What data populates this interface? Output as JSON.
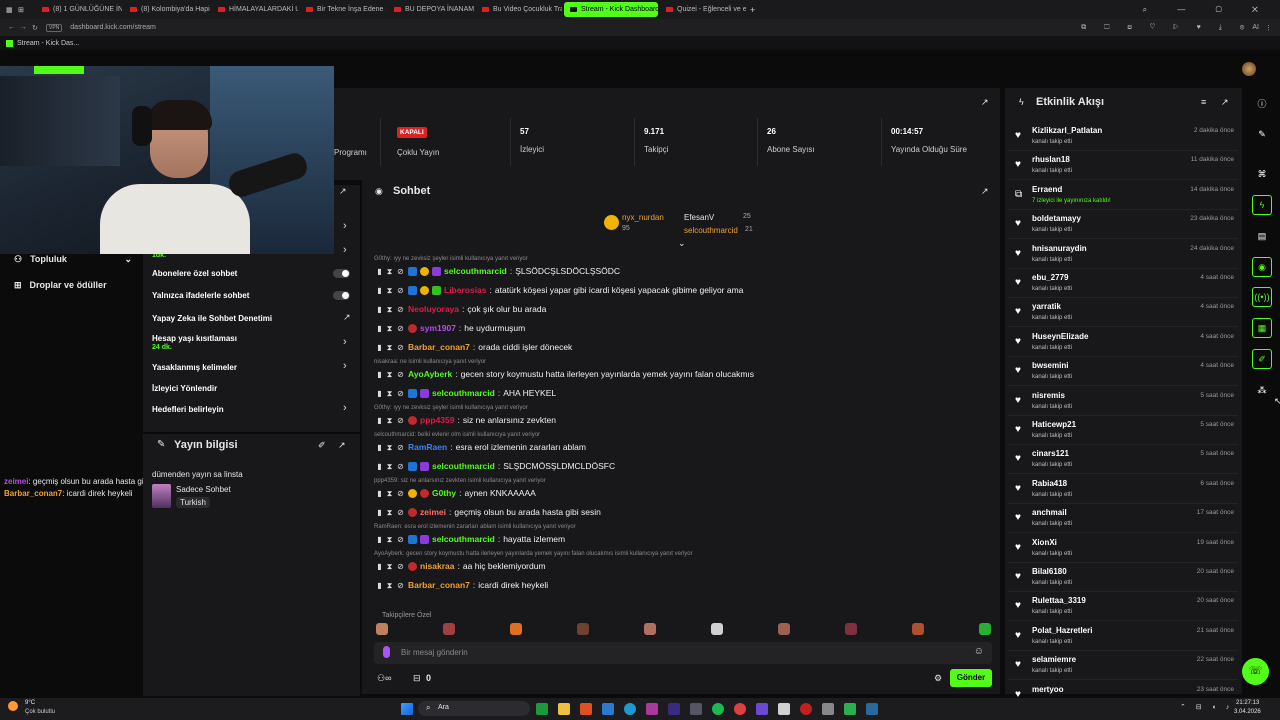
{
  "browser": {
    "tabs": [
      {
        "label": "(8) 1 GÜNLÜĞÜNE İNTER"
      },
      {
        "label": "(8) Kolombiya'da Hapish"
      },
      {
        "label": "HİMALAYALARDAKİ UÇAK"
      },
      {
        "label": "Bir Tekne İnşa Edene Kaç"
      },
      {
        "label": "BU DEPOYA İNANAMAYA"
      },
      {
        "label": "Bu Video Çocukluk Travm"
      },
      {
        "label": "Stream - Kick Dashboard"
      },
      {
        "label": "Quizei - Eğlenceli ve etkin"
      }
    ],
    "address": "dashboard.kick.com/stream",
    "bookmark": "Stream - Kick Das...",
    "ai_label": "AI"
  },
  "stats": [
    {
      "value": "",
      "label": "Programı"
    },
    {
      "value": "KAPALI",
      "label": "Çoklu Yayın"
    },
    {
      "value": "57",
      "label": "İzleyici"
    },
    {
      "value": "9.171",
      "label": "Takipçi"
    },
    {
      "value": "26",
      "label": "Abone Sayısı"
    },
    {
      "value": "00:14:57",
      "label": "Yayında Olduğu Süre"
    }
  ],
  "leftnav": {
    "items": [
      {
        "label": "Topluluk"
      },
      {
        "label": "Droplar ve ödüller"
      }
    ]
  },
  "chat_settings": {
    "partial_top": "1dk.",
    "items": [
      {
        "label": "Abonelere özel sohbet"
      },
      {
        "label": "Yalnızca ifadelerle sohbet"
      },
      {
        "label": "Yapay Zeka ile Sohbet Denetimi"
      },
      {
        "label": "Hesap yaşı kısıtlaması",
        "sub": "24 dk."
      },
      {
        "label": "Yasaklanmış kelimeler"
      },
      {
        "label": "İzleyici Yönlendir"
      },
      {
        "label": "Hedefleri belirleyin"
      }
    ]
  },
  "stream_info": {
    "title": "Yayın bilgisi",
    "stream_title": "dümenden yayın sa linsta",
    "category": "Sadece Sohbet",
    "language": "Turkish"
  },
  "overlay_chat": [
    {
      "user": "zeimei",
      "text": "geçmiş olsun bu arada hasta gibi sesin"
    },
    {
      "user": "Barbar_conan7",
      "text": "icardi direk heykeli"
    }
  ],
  "chat": {
    "title": "Sohbet",
    "top_gifters": [
      {
        "name": "nyx_nurdan",
        "count": "95"
      },
      {
        "name": "EfesanV",
        "count": "25"
      },
      {
        "name": "selcouthmarcid",
        "count": "21"
      }
    ],
    "messages": [
      {
        "reply": "G0thy: ıyy ne zevksiz şeyler isimli kullanıcıya yanıt veriyor",
        "user": "selcouthmarcid",
        "color": "#53fc18",
        "text": "ŞLSÖDCŞLSDÖCLŞSÖDC"
      },
      {
        "reply": "",
        "user": "Liberosias",
        "color": "#e0194a",
        "text": "atatürk köşesi yapar gibi icardi köşesi yapacak gibime geliyor ama"
      },
      {
        "reply": "",
        "user": "Neoluyoraya",
        "color": "#e0194a",
        "text": "çok şık olur bu arada"
      },
      {
        "reply": "",
        "user": "sym1907",
        "color": "#b84ce8",
        "text": "he uydurmuşum"
      },
      {
        "reply": "",
        "user": "Barbar_conan7",
        "color": "#f0a030",
        "text": "orada ciddi işler dönecek"
      },
      {
        "reply": "nisakraa: ne isimli kullanıcıya yanıt veriyor",
        "user": "AyoAyberk",
        "color": "#53fc18",
        "text": "gecen story koymustu hatta ilerleyen yayınlarda yemek yayını falan olucakmıs"
      },
      {
        "reply": "",
        "user": "selcouthmarcid",
        "color": "#53fc18",
        "text": "AHA HEYKEL"
      },
      {
        "reply": "G0thy: ıyy ne zevksiz şeyler isimli kullanıcıya yanıt veriyor",
        "user": "ppp4359",
        "color": "#e0194a",
        "text": "siz ne anlarsınız zevkten"
      },
      {
        "reply": "selcouthmarcid: belki evlenir olm isimli kullanıcıya yanıt veriyor",
        "user": "RamRaen",
        "color": "#3b82f6",
        "text": "esra erol izlemenin zararları ablam"
      },
      {
        "reply": "",
        "user": "selcouthmarcid",
        "color": "#53fc18",
        "text": "SLŞDCMÖSŞLDMCLDÖSFC"
      },
      {
        "reply": "ppp4359: siz ne anlarsınız zevkten isimli kullanıcıya yanıt veriyor",
        "user": "G0thy",
        "color": "#53fc18",
        "text": "aynen KNKAAAAA"
      },
      {
        "reply": "",
        "user": "zeimei",
        "color": "#ff6b6b",
        "text": "geçmiş olsun bu arada hasta gibi sesin"
      },
      {
        "reply": "RamRaen: esra erol izlemenin zararları ablam isimli kullanıcıya yanıt veriyor",
        "user": "selcouthmarcid",
        "color": "#53fc18",
        "text": "hayatta izlemem"
      },
      {
        "reply": "AyoAyberk: gecen story koymustu hatta ilerleyen yayınlarda yemek yayını falan olucakmıs isimli kullanıcıya yanıt veriyor",
        "user": "nisakraa",
        "color": "#f0a030",
        "text": "aa hiç beklemiyordum"
      },
      {
        "reply": "",
        "user": "Barbar_conan7",
        "color": "#f0a030",
        "text": "icardi direk heykeli"
      }
    ],
    "followers_label": "Takipçilere Özel",
    "input_placeholder": "Bir mesaj gönderin",
    "points": "0",
    "send_label": "Gönder"
  },
  "activity": {
    "title": "Etkinlik Akışı",
    "events": [
      {
        "name": "Kizlikzarl_Patlatan",
        "sub": "kanalı takip etti",
        "time": "2 dakika önce",
        "icon": "heart"
      },
      {
        "name": "rhuslan18",
        "sub": "kanalı takip etti",
        "time": "11 dakika önce",
        "icon": "heart"
      },
      {
        "name": "Erraend",
        "sub": "7 izleyici ile yayınınıza katıldı!",
        "time": "14 dakika önce",
        "icon": "raid"
      },
      {
        "name": "boldetamayy",
        "sub": "kanalı takip etti",
        "time": "23 dakika önce",
        "icon": "heart"
      },
      {
        "name": "hnisanuraydin",
        "sub": "kanalı takip etti",
        "time": "24 dakika önce",
        "icon": "heart"
      },
      {
        "name": "ebu_2779",
        "sub": "kanalı takip etti",
        "time": "4 saat önce",
        "icon": "heart"
      },
      {
        "name": "yarratik",
        "sub": "kanalı takip etti",
        "time": "4 saat önce",
        "icon": "heart"
      },
      {
        "name": "HuseynElizade",
        "sub": "kanalı takip etti",
        "time": "4 saat önce",
        "icon": "heart"
      },
      {
        "name": "bwsemini",
        "sub": "kanalı takip etti",
        "time": "4 saat önce",
        "icon": "heart"
      },
      {
        "name": "nisremis",
        "sub": "kanalı takip etti",
        "time": "5 saat önce",
        "icon": "heart"
      },
      {
        "name": "Haticewp21",
        "sub": "kanalı takip etti",
        "time": "5 saat önce",
        "icon": "heart"
      },
      {
        "name": "cinars121",
        "sub": "kanalı takip etti",
        "time": "5 saat önce",
        "icon": "heart"
      },
      {
        "name": "Rabia418",
        "sub": "kanalı takip etti",
        "time": "6 saat önce",
        "icon": "heart"
      },
      {
        "name": "anchmail",
        "sub": "kanalı takip etti",
        "time": "17 saat önce",
        "icon": "heart"
      },
      {
        "name": "XionXi",
        "sub": "kanalı takip etti",
        "time": "19 saat önce",
        "icon": "heart"
      },
      {
        "name": "Bilal6180",
        "sub": "kanalı takip etti",
        "time": "20 saat önce",
        "icon": "heart"
      },
      {
        "name": "Rulettaa_3319",
        "sub": "kanalı takip etti",
        "time": "20 saat önce",
        "icon": "heart"
      },
      {
        "name": "Polat_Hazretleri",
        "sub": "kanalı takip etti",
        "time": "21 saat önce",
        "icon": "heart"
      },
      {
        "name": "selamiemre",
        "sub": "kanalı takip etti",
        "time": "22 saat önce",
        "icon": "heart"
      },
      {
        "name": "mertyoo",
        "sub": "",
        "time": "23 saat önce",
        "icon": "heart"
      }
    ]
  },
  "taskbar": {
    "weather_temp": "9°C",
    "weather_desc": "Çok bulutlu",
    "search": "Ara",
    "time": "21:27:13",
    "date": "3.04.2026"
  },
  "colors": {
    "accent": "#53fc18",
    "panel": "#18181b",
    "background": "#0b0b0c"
  }
}
